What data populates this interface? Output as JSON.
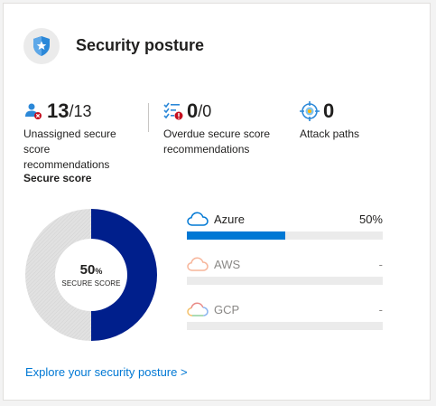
{
  "header": {
    "title": "Security posture",
    "icon": "shield-star-icon"
  },
  "metrics": {
    "unassigned": {
      "value": "13",
      "denominator": "/13",
      "description": "Unassigned secure score recommendations",
      "icon": "user-x-icon"
    },
    "overdue": {
      "value": "0",
      "denominator": "/0",
      "description": "Overdue secure score recommendations",
      "icon": "checklist-alert-icon"
    },
    "attack_paths": {
      "value": "0",
      "description": "Attack paths",
      "icon": "target-icon"
    }
  },
  "secure_score": {
    "label": "Secure score",
    "percent_value": "50",
    "percent_sign": "%",
    "center_label": "SECURE SCORE",
    "fraction": 0.5,
    "colors": {
      "filled": "#001f8c",
      "remaining": "#dedede"
    }
  },
  "clouds": [
    {
      "name": "Azure",
      "value": "50%",
      "fraction": 0.5,
      "icon": "azure-cloud-icon"
    },
    {
      "name": "AWS",
      "value": "-",
      "fraction": 0,
      "icon": "aws-cloud-icon"
    },
    {
      "name": "GCP",
      "value": "-",
      "fraction": 0,
      "icon": "gcp-cloud-icon"
    }
  ],
  "footer": {
    "link": "Explore your security posture >"
  }
}
